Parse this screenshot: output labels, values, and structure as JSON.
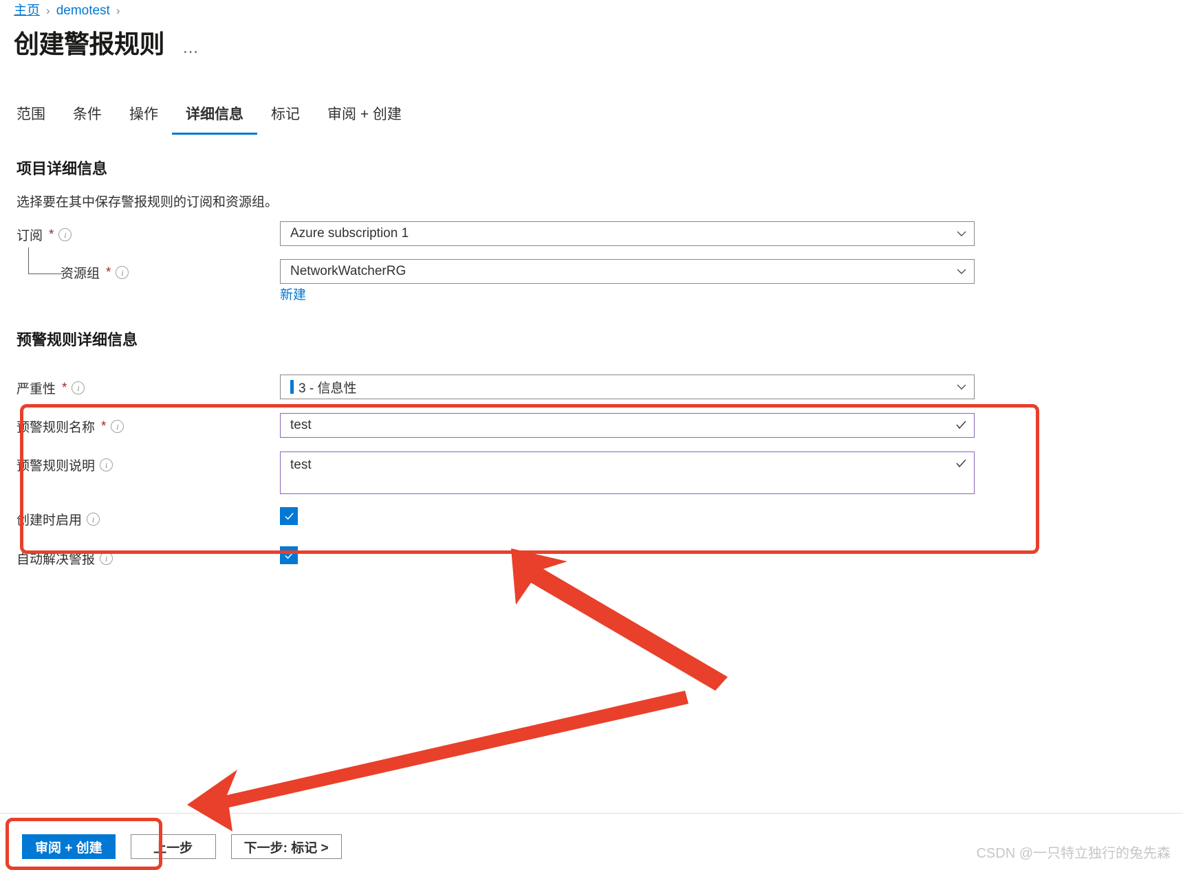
{
  "breadcrumb": {
    "items": [
      {
        "label": "主页"
      },
      {
        "label": "demotest"
      }
    ],
    "separator": "›"
  },
  "header": {
    "title": "创建警报规则",
    "more_menu": "…"
  },
  "tabs": [
    {
      "label": "范围",
      "active": false
    },
    {
      "label": "条件",
      "active": false
    },
    {
      "label": "操作",
      "active": false
    },
    {
      "label": "详细信息",
      "active": true
    },
    {
      "label": "标记",
      "active": false
    },
    {
      "label": "审阅 + 创建",
      "active": false
    }
  ],
  "project_details": {
    "heading": "项目详细信息",
    "description": "选择要在其中保存警报规则的订阅和资源组。",
    "subscription": {
      "label": "订阅",
      "required_marker": "*",
      "value": "Azure subscription 1"
    },
    "resource_group": {
      "label": "资源组",
      "required_marker": "*",
      "value": "NetworkWatcherRG",
      "new_link": "新建"
    }
  },
  "alert_rule_details": {
    "heading": "预警规则详细信息",
    "severity": {
      "label": "严重性",
      "required_marker": "*",
      "value": "3 - 信息性"
    },
    "rule_name": {
      "label": "预警规则名称",
      "required_marker": "*",
      "value": "test"
    },
    "rule_description": {
      "label": "预警规则说明",
      "value": "test"
    },
    "enable_on_create": {
      "label": "创建时启用",
      "checked": true
    },
    "auto_resolve": {
      "label": "自动解决警报",
      "checked": true
    }
  },
  "footer": {
    "review_create": "审阅 + 创建",
    "previous": "上一步",
    "next": "下一步: 标记 >"
  },
  "watermark": "CSDN @一只特立独行的兔先森",
  "colors": {
    "accent": "#0078d4",
    "annotation": "#e8402a",
    "validated_border": "#8764b8",
    "required": "#a4262c"
  }
}
